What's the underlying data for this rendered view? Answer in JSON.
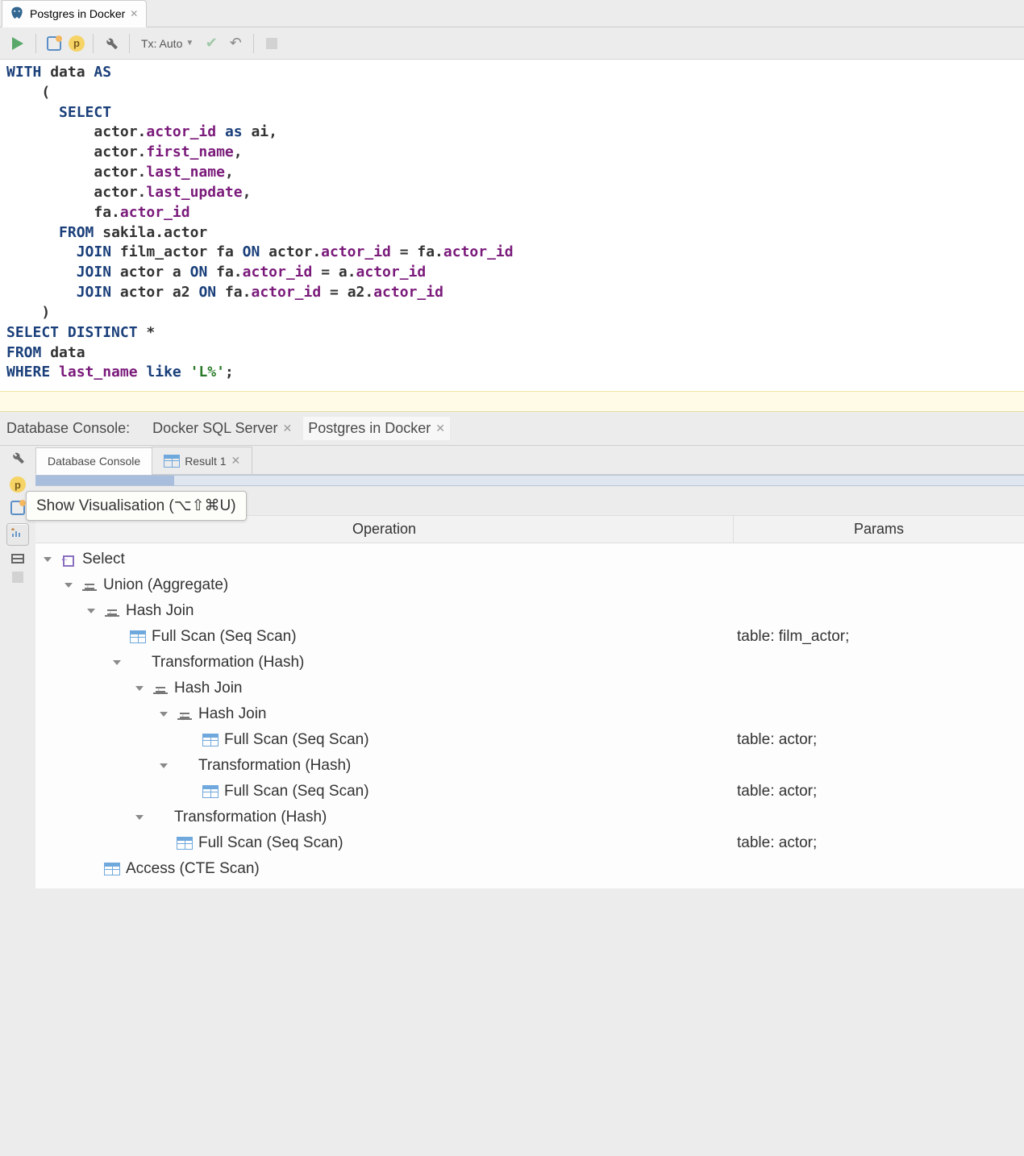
{
  "editor_tab": {
    "title": "Postgres in Docker"
  },
  "toolbar": {
    "tx_label": "Tx: Auto"
  },
  "sql_tokens": [
    [
      {
        "t": "WITH",
        "c": "kw"
      },
      {
        "t": " data ",
        "c": ""
      },
      {
        "t": "AS",
        "c": "kw"
      }
    ],
    [
      {
        "t": "    (",
        "c": ""
      }
    ],
    [
      {
        "t": "      ",
        "c": ""
      },
      {
        "t": "SELECT",
        "c": "kw"
      }
    ],
    [
      {
        "t": "          actor.",
        "c": ""
      },
      {
        "t": "actor_id",
        "c": "fld"
      },
      {
        "t": " ",
        "c": ""
      },
      {
        "t": "as",
        "c": "kw"
      },
      {
        "t": " ai,",
        "c": ""
      }
    ],
    [
      {
        "t": "          actor.",
        "c": ""
      },
      {
        "t": "first_name",
        "c": "fld"
      },
      {
        "t": ",",
        "c": ""
      }
    ],
    [
      {
        "t": "          actor.",
        "c": ""
      },
      {
        "t": "last_name",
        "c": "fld"
      },
      {
        "t": ",",
        "c": ""
      }
    ],
    [
      {
        "t": "          actor.",
        "c": ""
      },
      {
        "t": "last_update",
        "c": "fld"
      },
      {
        "t": ",",
        "c": ""
      }
    ],
    [
      {
        "t": "          fa.",
        "c": ""
      },
      {
        "t": "actor_id",
        "c": "fld"
      }
    ],
    [
      {
        "t": "      ",
        "c": ""
      },
      {
        "t": "FROM",
        "c": "kw"
      },
      {
        "t": " sakila.actor",
        "c": ""
      }
    ],
    [
      {
        "t": "        ",
        "c": ""
      },
      {
        "t": "JOIN",
        "c": "kw"
      },
      {
        "t": " film_actor fa ",
        "c": ""
      },
      {
        "t": "ON",
        "c": "kw"
      },
      {
        "t": " actor.",
        "c": ""
      },
      {
        "t": "actor_id",
        "c": "fld"
      },
      {
        "t": " = fa.",
        "c": ""
      },
      {
        "t": "actor_id",
        "c": "fld"
      }
    ],
    [
      {
        "t": "        ",
        "c": ""
      },
      {
        "t": "JOIN",
        "c": "kw"
      },
      {
        "t": " actor a ",
        "c": ""
      },
      {
        "t": "ON",
        "c": "kw"
      },
      {
        "t": " fa.",
        "c": ""
      },
      {
        "t": "actor_id",
        "c": "fld"
      },
      {
        "t": " = a.",
        "c": ""
      },
      {
        "t": "actor_id",
        "c": "fld"
      }
    ],
    [
      {
        "t": "        ",
        "c": ""
      },
      {
        "t": "JOIN",
        "c": "kw"
      },
      {
        "t": " actor a2 ",
        "c": ""
      },
      {
        "t": "ON",
        "c": "kw"
      },
      {
        "t": " fa.",
        "c": ""
      },
      {
        "t": "actor_id",
        "c": "fld"
      },
      {
        "t": " = a2.",
        "c": ""
      },
      {
        "t": "actor_id",
        "c": "fld"
      }
    ],
    [
      {
        "t": "    )",
        "c": ""
      }
    ],
    [
      {
        "t": "SELECT",
        "c": "kw"
      },
      {
        "t": " ",
        "c": ""
      },
      {
        "t": "DISTINCT",
        "c": "kw"
      },
      {
        "t": " *",
        "c": ""
      }
    ],
    [
      {
        "t": "FROM",
        "c": "kw"
      },
      {
        "t": " data",
        "c": ""
      }
    ],
    [
      {
        "t": "WHERE",
        "c": "kw"
      },
      {
        "t": " ",
        "c": ""
      },
      {
        "t": "last_name",
        "c": "fld"
      },
      {
        "t": " ",
        "c": ""
      },
      {
        "t": "like",
        "c": "kw"
      },
      {
        "t": " ",
        "c": ""
      },
      {
        "t": "'L%'",
        "c": "str"
      },
      {
        "t": ";",
        "c": ""
      }
    ]
  ],
  "console": {
    "label": "Database Console:",
    "subsessions": [
      {
        "name": "Docker SQL Server",
        "closable": true,
        "active": false
      },
      {
        "name": "Postgres in Docker",
        "closable": true,
        "active": true
      }
    ]
  },
  "result_tabs": [
    {
      "label": "Database Console",
      "closable": false,
      "active": true,
      "icon": ""
    },
    {
      "label": "Result 1",
      "closable": true,
      "active": false,
      "icon": "table"
    }
  ],
  "tooltip": "Show Visualisation (⌥⇧⌘U)",
  "plan": {
    "headers": {
      "operation": "Operation",
      "params": "Params"
    },
    "rows": [
      {
        "indent": 0,
        "expandable": true,
        "icon": "select",
        "op": "Select",
        "params": ""
      },
      {
        "indent": 1,
        "expandable": true,
        "icon": "union",
        "op": "Union (Aggregate)",
        "params": ""
      },
      {
        "indent": 2,
        "expandable": true,
        "icon": "union",
        "op": "Hash Join",
        "params": ""
      },
      {
        "indent": 3,
        "expandable": false,
        "icon": "table",
        "op": "Full Scan (Seq Scan)",
        "params": "table: film_actor;"
      },
      {
        "indent": 3,
        "expandable": true,
        "icon": "",
        "op": "Transformation (Hash)",
        "params": ""
      },
      {
        "indent": 4,
        "expandable": true,
        "icon": "union",
        "op": "Hash Join",
        "params": ""
      },
      {
        "indent": 5,
        "expandable": true,
        "icon": "union",
        "op": "Hash Join",
        "params": ""
      },
      {
        "indent": 6,
        "expandable": false,
        "icon": "table",
        "op": "Full Scan (Seq Scan)",
        "params": "table: actor;"
      },
      {
        "indent": 5,
        "expandable": true,
        "icon": "",
        "op": "Transformation (Hash)",
        "params": ""
      },
      {
        "indent": 6,
        "expandable": false,
        "icon": "table",
        "op": "Full Scan (Seq Scan)",
        "params": "table: actor;"
      },
      {
        "indent": 4,
        "expandable": true,
        "icon": "",
        "op": "Transformation (Hash)",
        "params": ""
      },
      {
        "indent": 5,
        "expandable": false,
        "icon": "table",
        "op": "Full Scan (Seq Scan)",
        "params": "table: actor;"
      },
      {
        "indent": 2,
        "expandable": false,
        "icon": "table",
        "op": "Access (CTE Scan)",
        "params": ""
      }
    ]
  }
}
